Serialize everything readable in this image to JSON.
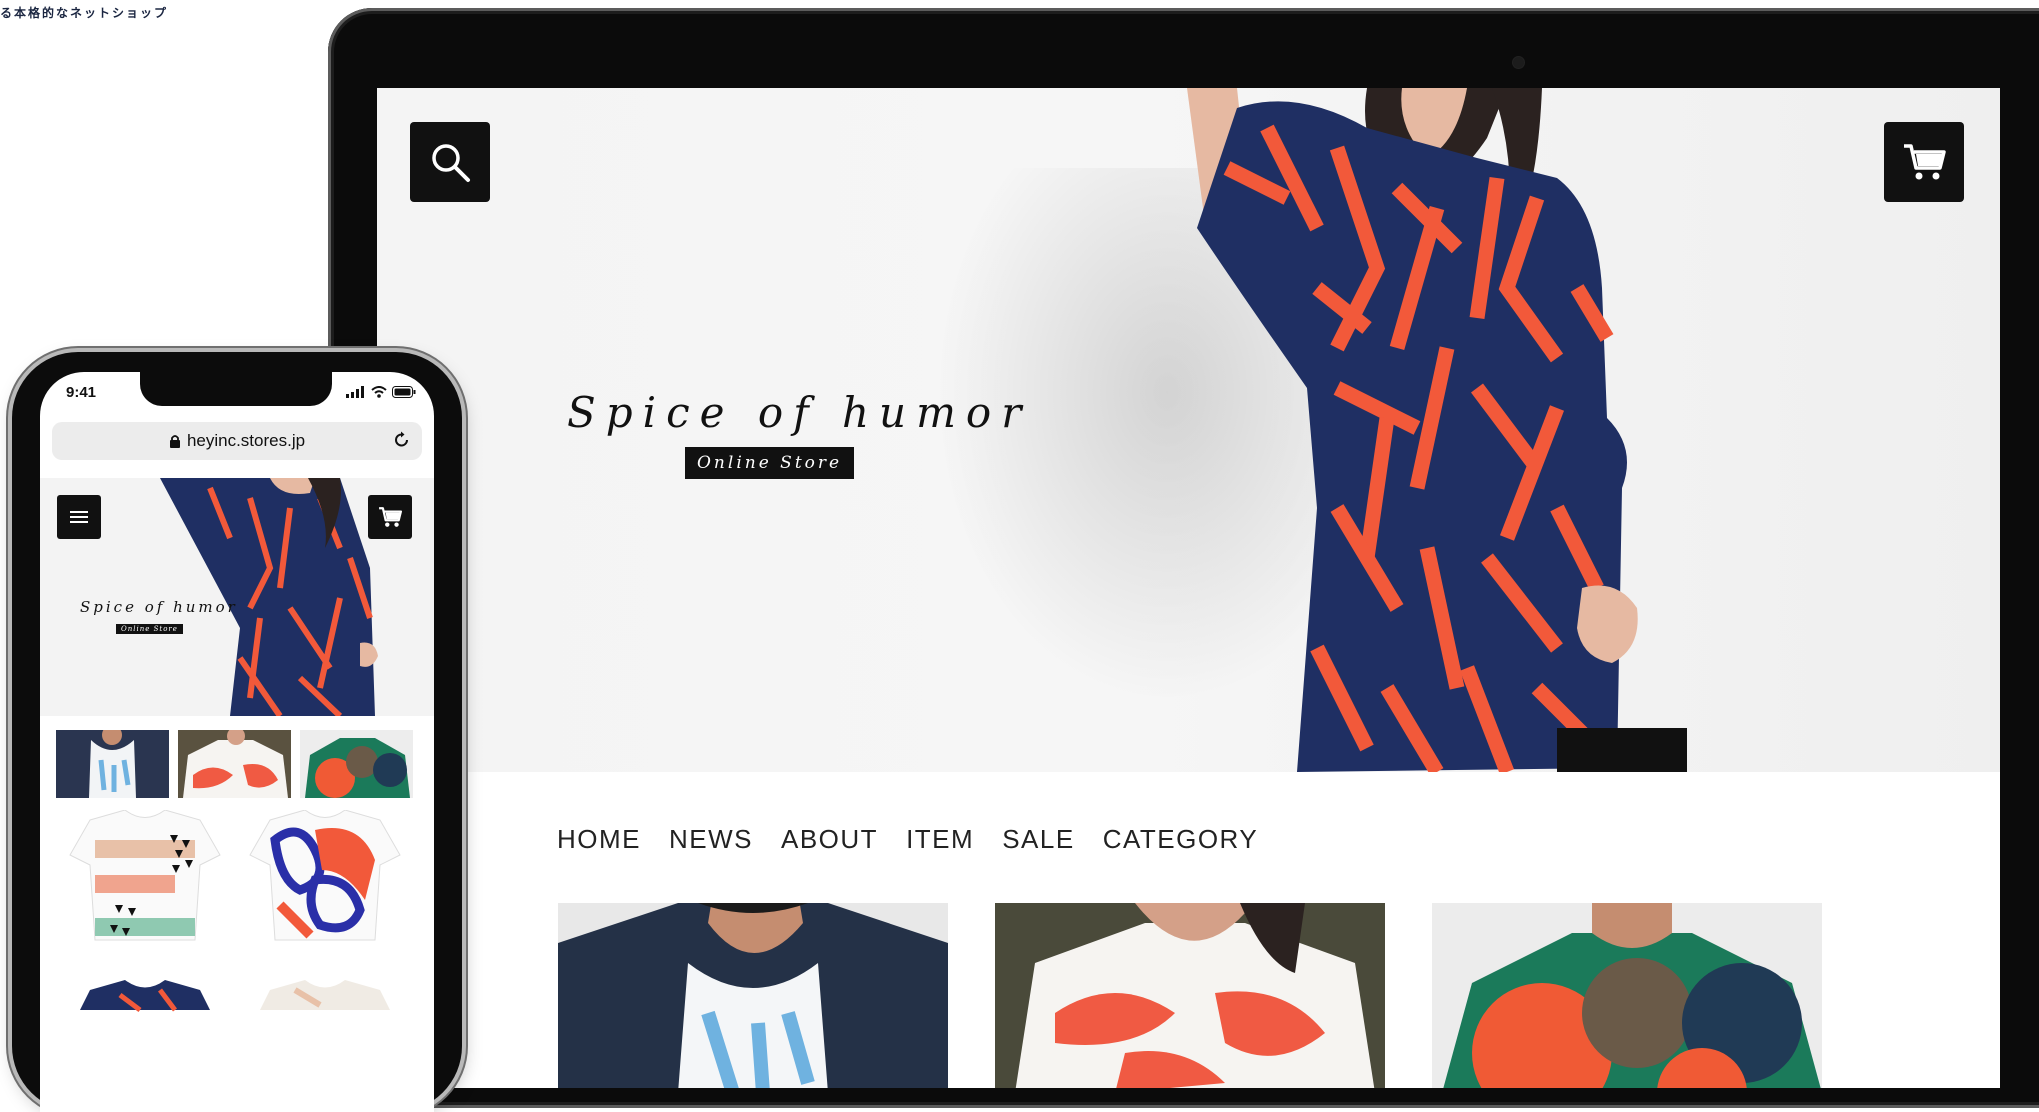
{
  "tagline": "る本格的なネットショップ",
  "desktop": {
    "store_name": "Spice of humor",
    "store_badge": "Online Store",
    "nav": [
      "HOME",
      "NEWS",
      "ABOUT",
      "ITEM",
      "SALE",
      "CATEGORY"
    ],
    "icons": {
      "search": "search-icon",
      "cart": "cart-icon"
    }
  },
  "phone": {
    "time": "9:41",
    "url": "heyinc.stores.jp",
    "store_name": "Spice of humor",
    "store_badge": "Online Store",
    "icons": {
      "menu": "hamburger-icon",
      "cart": "cart-icon",
      "lock": "lock-icon",
      "reload": "reload-icon"
    }
  },
  "colors": {
    "shirt_navy": "#1f2f63",
    "shirt_orange": "#f2593a",
    "dark": "#111111",
    "page_bg": "#ffffff"
  }
}
